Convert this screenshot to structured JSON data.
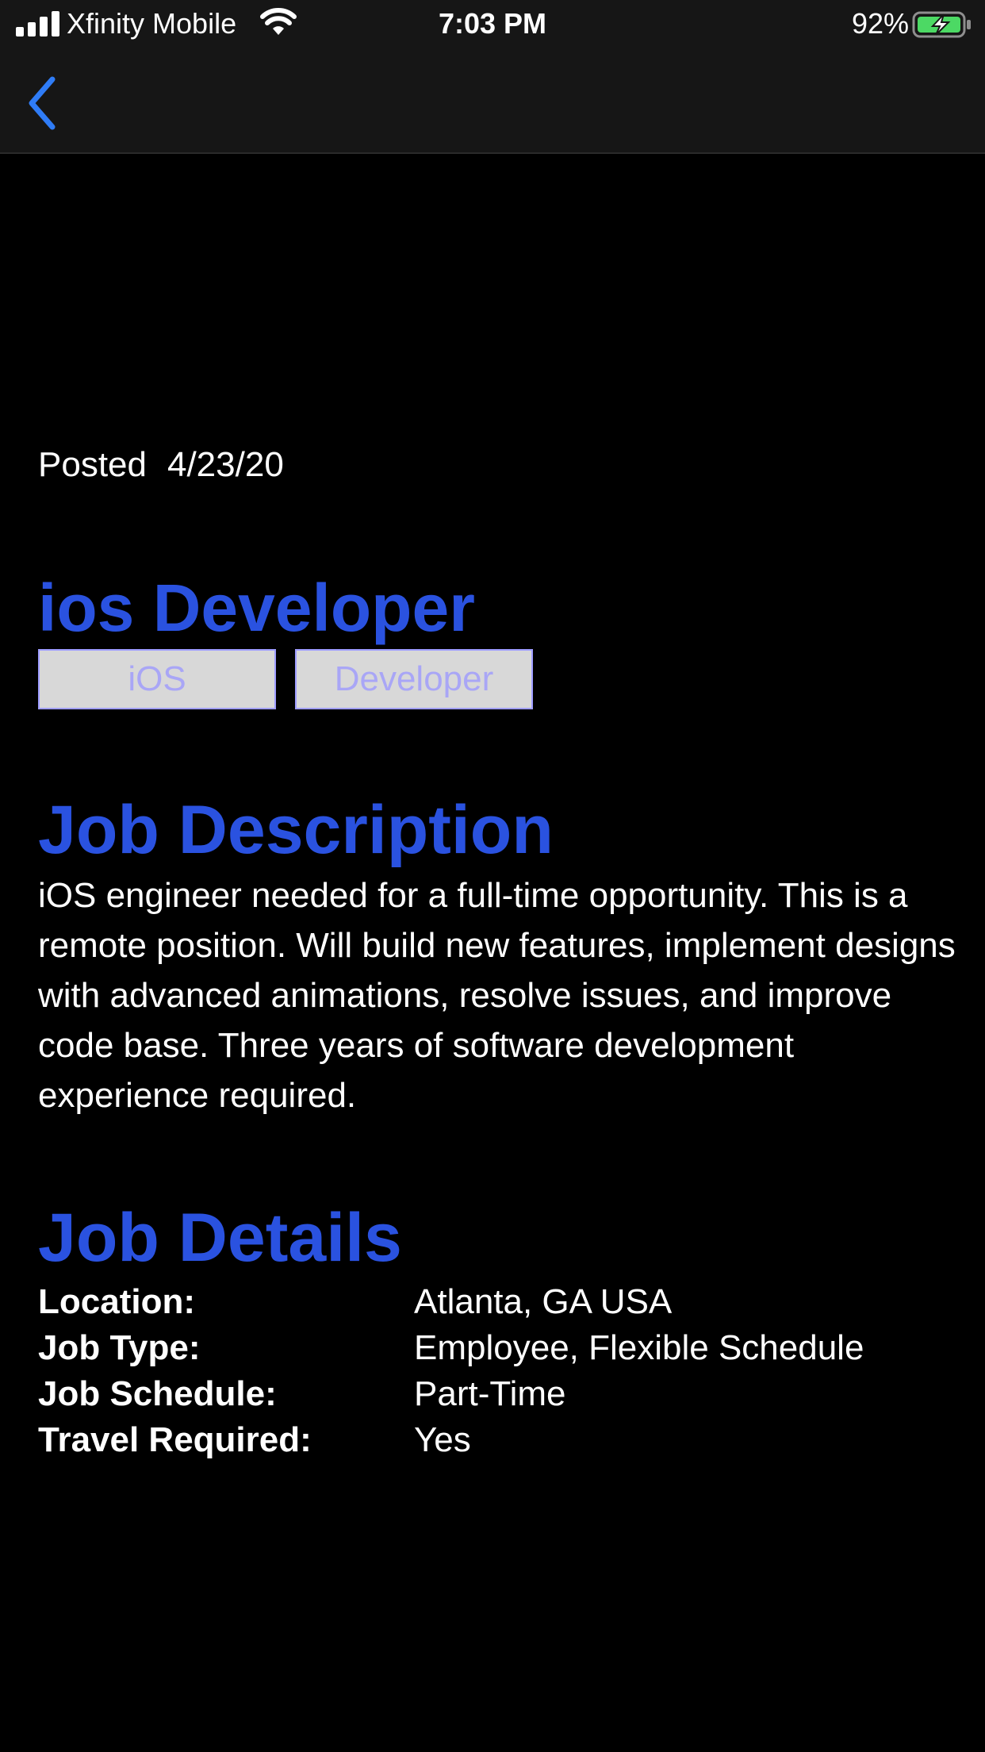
{
  "status_bar": {
    "carrier": "Xfinity Mobile",
    "time": "7:03 PM",
    "battery_percent": "92%"
  },
  "nav": {
    "back_icon": "chevron-left-icon"
  },
  "job": {
    "posted_label": "Posted",
    "posted_date": "4/23/20",
    "title": "ios Developer",
    "tags": [
      "iOS",
      "Developer"
    ],
    "description_heading": "Job Description",
    "description": "iOS engineer needed for a full-time opportunity. This is a remote position. Will build new features, implement designs with advanced animations, resolve issues, and improve code base. Three years of software development experience required.",
    "details_heading": "Job Details",
    "details": [
      {
        "label": "Location:",
        "value": "Atlanta, GA USA"
      },
      {
        "label": "Job Type:",
        "value": "Employee, Flexible Schedule"
      },
      {
        "label": "Job Schedule:",
        "value": "Part-Time"
      },
      {
        "label": "Travel Required:",
        "value": "Yes"
      }
    ]
  },
  "colors": {
    "accent": "#2a52e0",
    "tag_background": "#d8d8d8",
    "tag_text": "#a9a6f6",
    "back_arrow": "#2f7cf6",
    "battery_fill": "#4cd964"
  }
}
